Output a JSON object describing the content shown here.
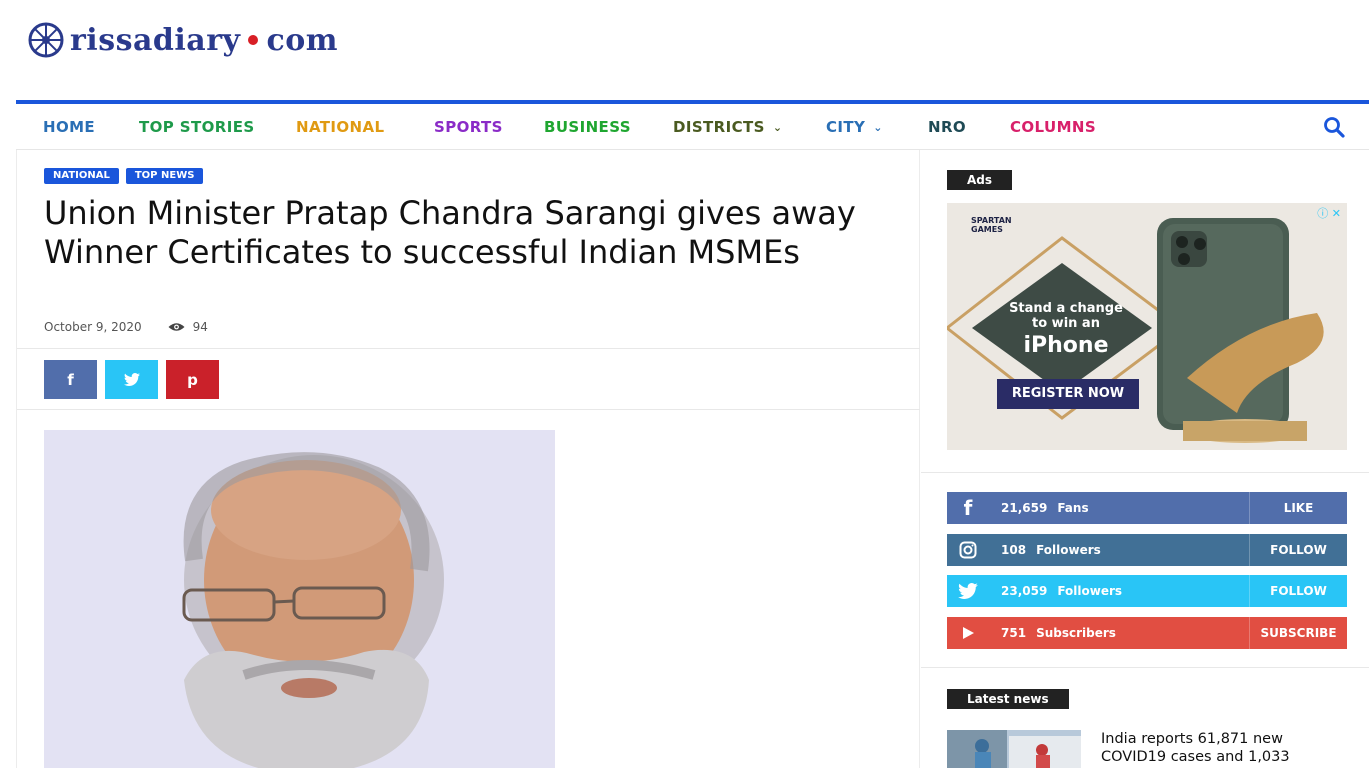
{
  "site": {
    "logo_text": "rissadiary",
    "logo_tld": "com"
  },
  "nav": {
    "items": [
      {
        "label": "HOME",
        "color": "#2a6fb5"
      },
      {
        "label": "TOP STORIES",
        "color": "#1e9a4a"
      },
      {
        "label": "NATIONAL",
        "color": "#e09a12"
      },
      {
        "label": "SPORTS",
        "color": "#8a2bc7"
      },
      {
        "label": "BUSINESS",
        "color": "#1fa630"
      },
      {
        "label": "DISTRICTS",
        "color": "#4a5a20"
      },
      {
        "label": "CITY",
        "color": "#2a6fb5"
      },
      {
        "label": "NRO",
        "color": "#1f4a55"
      },
      {
        "label": "COLUMNS",
        "color": "#d8206a"
      }
    ],
    "search_icon": "search-icon"
  },
  "article": {
    "tags": [
      "NATIONAL",
      "TOP NEWS"
    ],
    "title": "Union Minister Pratap Chandra Sarangi gives away Winner Certificates to successful Indian MSMEs",
    "date": "October 9, 2020",
    "views": "94",
    "share": [
      {
        "name": "facebook",
        "glyph": "f",
        "color": "#516eab"
      },
      {
        "name": "twitter",
        "glyph": "t",
        "color": "#29c5f6"
      },
      {
        "name": "pinterest",
        "glyph": "p",
        "color": "#ca212a"
      }
    ]
  },
  "sidebar": {
    "ads_label": "Ads",
    "ad": {
      "brand": "SPARTAN GAMES",
      "line1": "Stand a change",
      "line2": "to win an",
      "line3": "iPhone",
      "cta": "REGISTER NOW"
    },
    "social": [
      {
        "network": "facebook",
        "count": "21,659",
        "label": "Fans",
        "action": "LIKE",
        "color": "#516eab"
      },
      {
        "network": "instagram",
        "count": "108",
        "label": "Followers",
        "action": "FOLLOW",
        "color": "#417096"
      },
      {
        "network": "twitter",
        "count": "23,059",
        "label": "Followers",
        "action": "FOLLOW",
        "color": "#29c5f6"
      },
      {
        "network": "youtube",
        "count": "751",
        "label": "Subscribers",
        "action": "SUBSCRIBE",
        "color": "#e14e42"
      }
    ],
    "latest_label": "Latest news",
    "latest": [
      {
        "title": "India reports 61,871 new COVID19 cases and 1,033"
      }
    ]
  }
}
